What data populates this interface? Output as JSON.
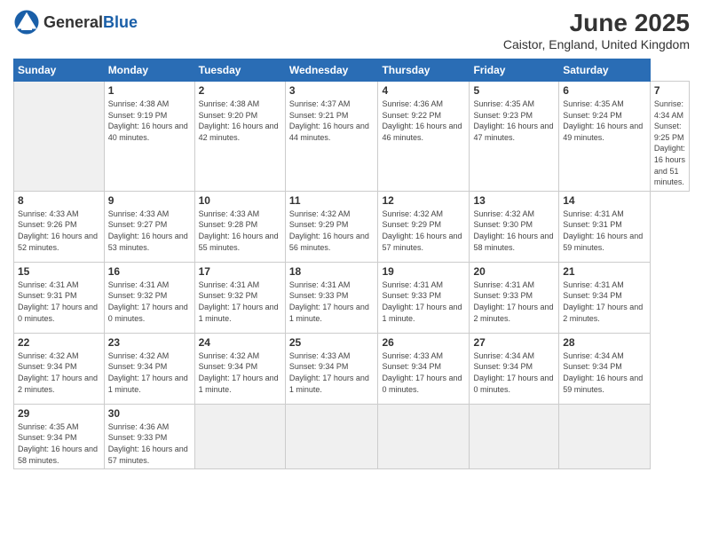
{
  "header": {
    "logo_general": "General",
    "logo_blue": "Blue",
    "month_year": "June 2025",
    "location": "Caistor, England, United Kingdom"
  },
  "calendar": {
    "days_of_week": [
      "Sunday",
      "Monday",
      "Tuesday",
      "Wednesday",
      "Thursday",
      "Friday",
      "Saturday"
    ],
    "weeks": [
      [
        {
          "day": "",
          "empty": true
        },
        {
          "day": "1",
          "sunrise": "Sunrise: 4:38 AM",
          "sunset": "Sunset: 9:19 PM",
          "daylight": "Daylight: 16 hours and 40 minutes."
        },
        {
          "day": "2",
          "sunrise": "Sunrise: 4:38 AM",
          "sunset": "Sunset: 9:20 PM",
          "daylight": "Daylight: 16 hours and 42 minutes."
        },
        {
          "day": "3",
          "sunrise": "Sunrise: 4:37 AM",
          "sunset": "Sunset: 9:21 PM",
          "daylight": "Daylight: 16 hours and 44 minutes."
        },
        {
          "day": "4",
          "sunrise": "Sunrise: 4:36 AM",
          "sunset": "Sunset: 9:22 PM",
          "daylight": "Daylight: 16 hours and 46 minutes."
        },
        {
          "day": "5",
          "sunrise": "Sunrise: 4:35 AM",
          "sunset": "Sunset: 9:23 PM",
          "daylight": "Daylight: 16 hours and 47 minutes."
        },
        {
          "day": "6",
          "sunrise": "Sunrise: 4:35 AM",
          "sunset": "Sunset: 9:24 PM",
          "daylight": "Daylight: 16 hours and 49 minutes."
        },
        {
          "day": "7",
          "sunrise": "Sunrise: 4:34 AM",
          "sunset": "Sunset: 9:25 PM",
          "daylight": "Daylight: 16 hours and 51 minutes."
        }
      ],
      [
        {
          "day": "8",
          "sunrise": "Sunrise: 4:33 AM",
          "sunset": "Sunset: 9:26 PM",
          "daylight": "Daylight: 16 hours and 52 minutes."
        },
        {
          "day": "9",
          "sunrise": "Sunrise: 4:33 AM",
          "sunset": "Sunset: 9:27 PM",
          "daylight": "Daylight: 16 hours and 53 minutes."
        },
        {
          "day": "10",
          "sunrise": "Sunrise: 4:33 AM",
          "sunset": "Sunset: 9:28 PM",
          "daylight": "Daylight: 16 hours and 55 minutes."
        },
        {
          "day": "11",
          "sunrise": "Sunrise: 4:32 AM",
          "sunset": "Sunset: 9:29 PM",
          "daylight": "Daylight: 16 hours and 56 minutes."
        },
        {
          "day": "12",
          "sunrise": "Sunrise: 4:32 AM",
          "sunset": "Sunset: 9:29 PM",
          "daylight": "Daylight: 16 hours and 57 minutes."
        },
        {
          "day": "13",
          "sunrise": "Sunrise: 4:32 AM",
          "sunset": "Sunset: 9:30 PM",
          "daylight": "Daylight: 16 hours and 58 minutes."
        },
        {
          "day": "14",
          "sunrise": "Sunrise: 4:31 AM",
          "sunset": "Sunset: 9:31 PM",
          "daylight": "Daylight: 16 hours and 59 minutes."
        }
      ],
      [
        {
          "day": "15",
          "sunrise": "Sunrise: 4:31 AM",
          "sunset": "Sunset: 9:31 PM",
          "daylight": "Daylight: 17 hours and 0 minutes."
        },
        {
          "day": "16",
          "sunrise": "Sunrise: 4:31 AM",
          "sunset": "Sunset: 9:32 PM",
          "daylight": "Daylight: 17 hours and 0 minutes."
        },
        {
          "day": "17",
          "sunrise": "Sunrise: 4:31 AM",
          "sunset": "Sunset: 9:32 PM",
          "daylight": "Daylight: 17 hours and 1 minute."
        },
        {
          "day": "18",
          "sunrise": "Sunrise: 4:31 AM",
          "sunset": "Sunset: 9:33 PM",
          "daylight": "Daylight: 17 hours and 1 minute."
        },
        {
          "day": "19",
          "sunrise": "Sunrise: 4:31 AM",
          "sunset": "Sunset: 9:33 PM",
          "daylight": "Daylight: 17 hours and 1 minute."
        },
        {
          "day": "20",
          "sunrise": "Sunrise: 4:31 AM",
          "sunset": "Sunset: 9:33 PM",
          "daylight": "Daylight: 17 hours and 2 minutes."
        },
        {
          "day": "21",
          "sunrise": "Sunrise: 4:31 AM",
          "sunset": "Sunset: 9:34 PM",
          "daylight": "Daylight: 17 hours and 2 minutes."
        }
      ],
      [
        {
          "day": "22",
          "sunrise": "Sunrise: 4:32 AM",
          "sunset": "Sunset: 9:34 PM",
          "daylight": "Daylight: 17 hours and 2 minutes."
        },
        {
          "day": "23",
          "sunrise": "Sunrise: 4:32 AM",
          "sunset": "Sunset: 9:34 PM",
          "daylight": "Daylight: 17 hours and 1 minute."
        },
        {
          "day": "24",
          "sunrise": "Sunrise: 4:32 AM",
          "sunset": "Sunset: 9:34 PM",
          "daylight": "Daylight: 17 hours and 1 minute."
        },
        {
          "day": "25",
          "sunrise": "Sunrise: 4:33 AM",
          "sunset": "Sunset: 9:34 PM",
          "daylight": "Daylight: 17 hours and 1 minute."
        },
        {
          "day": "26",
          "sunrise": "Sunrise: 4:33 AM",
          "sunset": "Sunset: 9:34 PM",
          "daylight": "Daylight: 17 hours and 0 minutes."
        },
        {
          "day": "27",
          "sunrise": "Sunrise: 4:34 AM",
          "sunset": "Sunset: 9:34 PM",
          "daylight": "Daylight: 17 hours and 0 minutes."
        },
        {
          "day": "28",
          "sunrise": "Sunrise: 4:34 AM",
          "sunset": "Sunset: 9:34 PM",
          "daylight": "Daylight: 16 hours and 59 minutes."
        }
      ],
      [
        {
          "day": "29",
          "sunrise": "Sunrise: 4:35 AM",
          "sunset": "Sunset: 9:34 PM",
          "daylight": "Daylight: 16 hours and 58 minutes."
        },
        {
          "day": "30",
          "sunrise": "Sunrise: 4:36 AM",
          "sunset": "Sunset: 9:33 PM",
          "daylight": "Daylight: 16 hours and 57 minutes."
        },
        {
          "day": "",
          "empty": true
        },
        {
          "day": "",
          "empty": true
        },
        {
          "day": "",
          "empty": true
        },
        {
          "day": "",
          "empty": true
        },
        {
          "day": "",
          "empty": true
        }
      ]
    ]
  }
}
